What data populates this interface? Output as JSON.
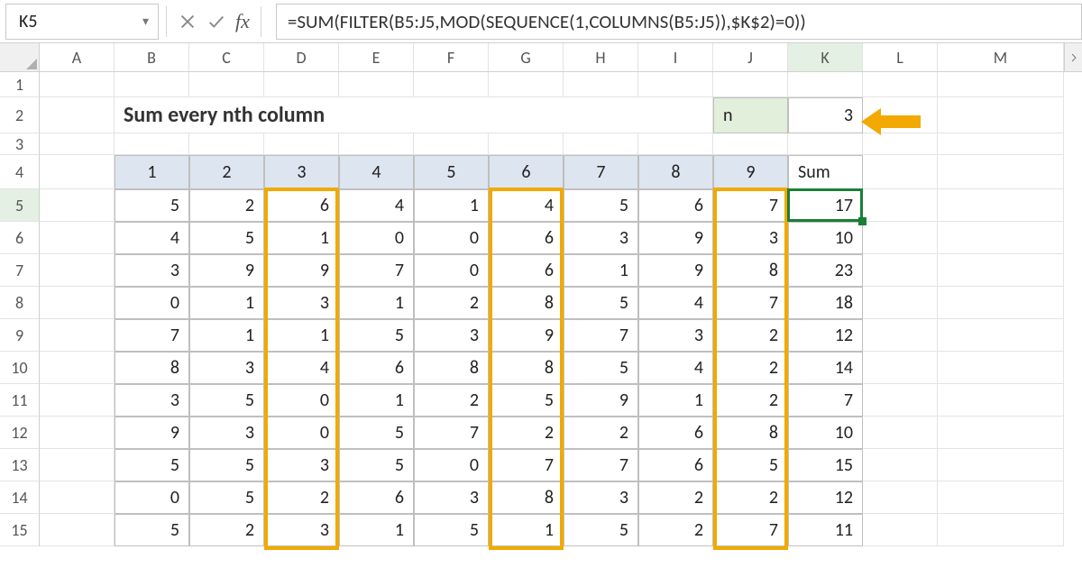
{
  "namebox": "K5",
  "formula": "=SUM(FILTER(B5:J5,MOD(SEQUENCE(1,COLUMNS(B5:J5)),$K$2)=0))",
  "columns": [
    "A",
    "B",
    "C",
    "D",
    "E",
    "F",
    "G",
    "H",
    "I",
    "J",
    "K",
    "L",
    "M"
  ],
  "active_col": "K",
  "row_labels": [
    "1",
    "2",
    "3",
    "4",
    "5",
    "6",
    "7",
    "8",
    "9",
    "10",
    "11",
    "12",
    "13",
    "14",
    "15"
  ],
  "active_row": "5",
  "title": "Sum every nth column",
  "n_label": "n",
  "n_value": "3",
  "data_headers": [
    "1",
    "2",
    "3",
    "4",
    "5",
    "6",
    "7",
    "8",
    "9",
    "Sum"
  ],
  "data_rows": [
    [
      "5",
      "2",
      "6",
      "4",
      "1",
      "4",
      "5",
      "6",
      "7",
      "17"
    ],
    [
      "4",
      "5",
      "1",
      "0",
      "0",
      "6",
      "3",
      "9",
      "3",
      "10"
    ],
    [
      "3",
      "9",
      "9",
      "7",
      "0",
      "6",
      "1",
      "9",
      "8",
      "23"
    ],
    [
      "0",
      "1",
      "3",
      "1",
      "2",
      "8",
      "5",
      "4",
      "7",
      "18"
    ],
    [
      "7",
      "1",
      "1",
      "5",
      "3",
      "9",
      "7",
      "3",
      "2",
      "12"
    ],
    [
      "8",
      "3",
      "4",
      "6",
      "8",
      "8",
      "5",
      "4",
      "2",
      "14"
    ],
    [
      "3",
      "5",
      "0",
      "1",
      "2",
      "5",
      "9",
      "1",
      "2",
      "7"
    ],
    [
      "9",
      "3",
      "0",
      "5",
      "7",
      "2",
      "2",
      "6",
      "8",
      "10"
    ],
    [
      "5",
      "5",
      "3",
      "5",
      "0",
      "7",
      "7",
      "6",
      "5",
      "15"
    ],
    [
      "0",
      "5",
      "2",
      "6",
      "3",
      "8",
      "3",
      "2",
      "2",
      "12"
    ],
    [
      "5",
      "2",
      "3",
      "1",
      "5",
      "1",
      "5",
      "2",
      "7",
      "11"
    ]
  ],
  "chart_data": {
    "type": "table",
    "title": "Sum every nth column",
    "parameter_n": 3,
    "highlighted_columns": [
      3,
      6,
      9
    ],
    "columns": [
      "1",
      "2",
      "3",
      "4",
      "5",
      "6",
      "7",
      "8",
      "9",
      "Sum"
    ],
    "rows": [
      [
        5,
        2,
        6,
        4,
        1,
        4,
        5,
        6,
        7,
        17
      ],
      [
        4,
        5,
        1,
        0,
        0,
        6,
        3,
        9,
        3,
        10
      ],
      [
        3,
        9,
        9,
        7,
        0,
        6,
        1,
        9,
        8,
        23
      ],
      [
        0,
        1,
        3,
        1,
        2,
        8,
        5,
        4,
        7,
        18
      ],
      [
        7,
        1,
        1,
        5,
        3,
        9,
        7,
        3,
        2,
        12
      ],
      [
        8,
        3,
        4,
        6,
        8,
        8,
        5,
        4,
        2,
        14
      ],
      [
        3,
        5,
        0,
        1,
        2,
        5,
        9,
        1,
        2,
        7
      ],
      [
        9,
        3,
        0,
        5,
        7,
        2,
        2,
        6,
        8,
        10
      ],
      [
        5,
        5,
        3,
        5,
        0,
        7,
        7,
        6,
        5,
        15
      ],
      [
        0,
        5,
        2,
        6,
        3,
        8,
        3,
        2,
        2,
        12
      ],
      [
        5,
        2,
        3,
        1,
        5,
        1,
        5,
        2,
        7,
        11
      ]
    ]
  }
}
